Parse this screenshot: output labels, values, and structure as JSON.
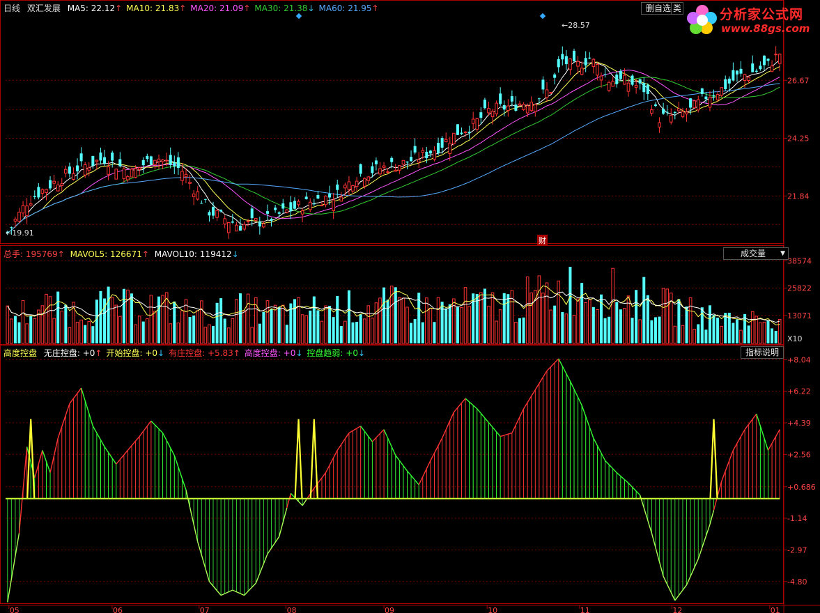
{
  "price_panel": {
    "period": "日线",
    "stock_name": "双汇发展",
    "ma": [
      {
        "label": "MA5:",
        "value": "22.12",
        "arrow": "↑",
        "color": "#ffffff"
      },
      {
        "label": "MA10:",
        "value": "21.83",
        "arrow": "↑",
        "color": "#ffff55"
      },
      {
        "label": "MA20:",
        "value": "21.09",
        "arrow": "↑",
        "color": "#ff55ff"
      },
      {
        "label": "MA30:",
        "value": "21.38",
        "arrow": "↓",
        "color": "#33cc33"
      },
      {
        "label": "MA60:",
        "value": "21.95",
        "arrow": "↑",
        "color": "#55aaff"
      }
    ],
    "y_ticks": [
      "26.67",
      "24.25",
      "21.84"
    ],
    "high_label": "28.57",
    "low_label": "19.91",
    "fin_marker": "财",
    "btn_remove": "删自选",
    "btn_extra": "类"
  },
  "volume_panel": {
    "title": "总手:",
    "total": "195769",
    "total_arrow": "↑",
    "mavol5_label": "MAVOL5:",
    "mavol5": "126671",
    "mavol5_arrow": "↑",
    "mavol10_label": "MAVOL10:",
    "mavol10": "119412",
    "mavol10_arrow": "↓",
    "dropdown": "成交量",
    "y_ticks": [
      "38574",
      "25822",
      "13071"
    ],
    "unit": "X10"
  },
  "indicator_panel": {
    "name": "高度控盘",
    "items": [
      {
        "label": "无庄控盘:",
        "value": "+0",
        "arrow": "↑",
        "color": "#ffffff"
      },
      {
        "label": "开始控盘:",
        "value": "+0",
        "arrow": "↓",
        "color": "#ffff55"
      },
      {
        "label": "有庄控盘:",
        "value": "+5.83",
        "arrow": "↑",
        "color": "#ff3333"
      },
      {
        "label": "高度控盘:",
        "value": "+0",
        "arrow": "↓",
        "color": "#ff55ff"
      },
      {
        "label": "控盘趋弱:",
        "value": "+0",
        "arrow": "↓",
        "color": "#33ff33"
      }
    ],
    "btn_help": "指标说明",
    "y_ticks": [
      "+8.04",
      "+6.22",
      "+4.39",
      "+2.56",
      "+0.686",
      "-1.14",
      "-2.97",
      "-4.80"
    ]
  },
  "x_axis": {
    "ticks": [
      "05",
      "06",
      "07",
      "08",
      "09",
      "10",
      "11",
      "12",
      "01"
    ]
  },
  "logo": {
    "title": "分析家公式网",
    "url": "www.88gs.com"
  },
  "chart_data": {
    "type": "candlestick",
    "price_ylim": [
      19.9,
      29.5
    ],
    "price_yticks": [
      26.67,
      24.25,
      21.84
    ],
    "volume_ylim": [
      0,
      40000
    ],
    "volume_yticks": [
      38574,
      25822,
      13071
    ],
    "indicator_ylim": [
      -6.1,
      8.3
    ],
    "indicator_yticks": [
      8.04,
      6.22,
      4.39,
      2.56,
      0.686,
      -1.14,
      -2.97,
      -4.8
    ],
    "price_path": [
      [
        0,
        20.3
      ],
      [
        5,
        21.6
      ],
      [
        10,
        22.2
      ],
      [
        18,
        23.0
      ],
      [
        25,
        23.4
      ],
      [
        32,
        22.8
      ],
      [
        38,
        23.5
      ],
      [
        45,
        22.9
      ],
      [
        52,
        21.2
      ],
      [
        60,
        20.6
      ],
      [
        66,
        20.8
      ],
      [
        72,
        21.2
      ],
      [
        78,
        21.6
      ],
      [
        85,
        21.9
      ],
      [
        90,
        22.7
      ],
      [
        96,
        23.0
      ],
      [
        102,
        23.2
      ],
      [
        108,
        23.6
      ],
      [
        112,
        24.0
      ],
      [
        116,
        24.5
      ],
      [
        120,
        24.8
      ],
      [
        124,
        25.4
      ],
      [
        130,
        25.6
      ],
      [
        136,
        25.9
      ],
      [
        140,
        26.3
      ],
      [
        143,
        27.5
      ],
      [
        146,
        27.2
      ],
      [
        150,
        27.6
      ],
      [
        155,
        26.7
      ],
      [
        160,
        26.6
      ],
      [
        164,
        26.3
      ],
      [
        168,
        25.1
      ],
      [
        172,
        25.2
      ],
      [
        176,
        25.4
      ],
      [
        180,
        26.0
      ],
      [
        184,
        26.3
      ],
      [
        188,
        26.8
      ],
      [
        192,
        27.0
      ],
      [
        196,
        27.3
      ],
      [
        199,
        27.8
      ]
    ],
    "volume_path": [
      [
        0,
        12000
      ],
      [
        10,
        16000
      ],
      [
        18,
        14000
      ],
      [
        25,
        17000
      ],
      [
        30,
        16000
      ],
      [
        38,
        17000
      ],
      [
        45,
        14000
      ],
      [
        52,
        13000
      ],
      [
        60,
        15000
      ],
      [
        70,
        13000
      ],
      [
        80,
        15000
      ],
      [
        90,
        16000
      ],
      [
        100,
        17000
      ],
      [
        110,
        15500
      ],
      [
        120,
        17000
      ],
      [
        130,
        18000
      ],
      [
        140,
        22000
      ],
      [
        146,
        25000
      ],
      [
        150,
        24000
      ],
      [
        155,
        23000
      ],
      [
        160,
        19000
      ],
      [
        165,
        20000
      ],
      [
        170,
        16000
      ],
      [
        175,
        14000
      ],
      [
        180,
        12000
      ],
      [
        186,
        11000
      ],
      [
        192,
        10500
      ],
      [
        199,
        11500
      ]
    ],
    "indicator_path": [
      [
        0,
        -6.0
      ],
      [
        3,
        -2.0
      ],
      [
        5,
        3.0
      ],
      [
        7,
        1.2
      ],
      [
        9,
        2.8
      ],
      [
        11,
        1.5
      ],
      [
        13,
        3.5
      ],
      [
        16,
        5.5
      ],
      [
        19,
        6.4
      ],
      [
        22,
        4.2
      ],
      [
        25,
        3.0
      ],
      [
        28,
        2.0
      ],
      [
        31,
        2.8
      ],
      [
        34,
        3.6
      ],
      [
        37,
        4.5
      ],
      [
        40,
        3.8
      ],
      [
        43,
        2.5
      ],
      [
        46,
        0.5
      ],
      [
        49,
        -2.5
      ],
      [
        52,
        -4.8
      ],
      [
        55,
        -5.6
      ],
      [
        58,
        -5.3
      ],
      [
        61,
        -5.6
      ],
      [
        64,
        -4.9
      ],
      [
        67,
        -3.2
      ],
      [
        70,
        -2.2
      ],
      [
        73,
        0.3
      ],
      [
        76,
        -0.4
      ],
      [
        79,
        0.6
      ],
      [
        82,
        1.5
      ],
      [
        85,
        2.8
      ],
      [
        88,
        3.8
      ],
      [
        91,
        4.2
      ],
      [
        94,
        3.3
      ],
      [
        97,
        4.0
      ],
      [
        100,
        2.5
      ],
      [
        103,
        1.6
      ],
      [
        106,
        0.8
      ],
      [
        109,
        2.2
      ],
      [
        112,
        3.5
      ],
      [
        115,
        5.0
      ],
      [
        118,
        5.8
      ],
      [
        121,
        5.2
      ],
      [
        124,
        4.4
      ],
      [
        127,
        3.6
      ],
      [
        130,
        3.8
      ],
      [
        133,
        5.2
      ],
      [
        136,
        6.3
      ],
      [
        139,
        7.4
      ],
      [
        142,
        8.1
      ],
      [
        145,
        6.8
      ],
      [
        148,
        5.4
      ],
      [
        151,
        3.5
      ],
      [
        154,
        2.2
      ],
      [
        157,
        1.5
      ],
      [
        160,
        0.9
      ],
      [
        163,
        0.2
      ],
      [
        166,
        -2.0
      ],
      [
        169,
        -4.5
      ],
      [
        172,
        -5.9
      ],
      [
        175,
        -5.0
      ],
      [
        178,
        -3.5
      ],
      [
        181,
        -1.5
      ],
      [
        184,
        1.0
      ],
      [
        187,
        2.8
      ],
      [
        190,
        4.0
      ],
      [
        193,
        4.9
      ],
      [
        196,
        2.8
      ],
      [
        199,
        4.0
      ]
    ],
    "spikes": [
      [
        6,
        4.6
      ],
      [
        75,
        4.6
      ],
      [
        79,
        4.6
      ],
      [
        182,
        4.6
      ]
    ]
  }
}
